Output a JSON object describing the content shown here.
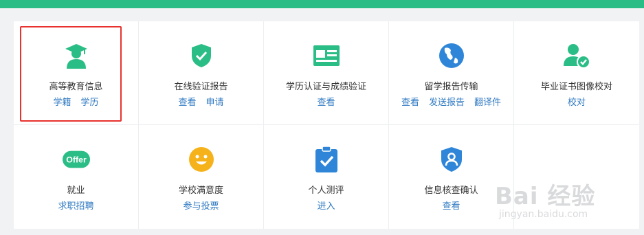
{
  "colors": {
    "accent": "#2bbd86",
    "link": "#2f79c2",
    "highlight_border": "#e8322e"
  },
  "services": [
    {
      "title": "高等教育信息",
      "icon": "graduate-cap-icon",
      "links": [
        "学籍",
        "学历"
      ],
      "selected": true
    },
    {
      "title": "在线验证报告",
      "icon": "shield-check-icon",
      "links": [
        "查看",
        "申请"
      ]
    },
    {
      "title": "学历认证与成绩验证",
      "icon": "id-card-icon",
      "links": [
        "查看"
      ]
    },
    {
      "title": "留学报告传输",
      "icon": "globe-icon",
      "links": [
        "查看",
        "发送报告",
        "翻译件"
      ]
    },
    {
      "title": "毕业证书图像校对",
      "icon": "user-check-icon",
      "links": [
        "校对"
      ]
    },
    {
      "title": "就业",
      "icon": "offer-badge-icon",
      "badge_text": "Offer",
      "links": [
        "求职招聘"
      ]
    },
    {
      "title": "学校满意度",
      "icon": "smiley-icon",
      "links": [
        "参与投票"
      ]
    },
    {
      "title": "个人测评",
      "icon": "clipboard-check-icon",
      "links": [
        "进入"
      ]
    },
    {
      "title": "信息核查确认",
      "icon": "shield-user-icon",
      "links": [
        "查看"
      ]
    }
  ],
  "watermark": {
    "main": "Bai 经验",
    "sub": "jingyan.baidu.com"
  }
}
